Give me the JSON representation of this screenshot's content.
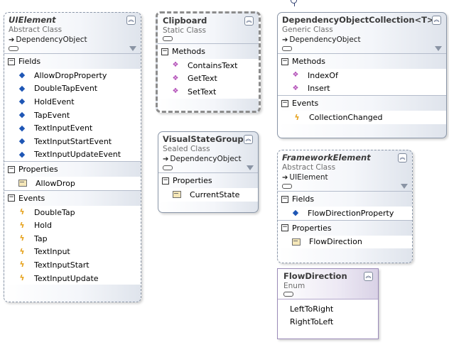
{
  "shapes": {
    "uielement": {
      "name": "UIElement",
      "kind": "Abstract Class",
      "base": "DependencyObject",
      "fields_title": "Fields",
      "fields": [
        "AllowDropProperty",
        "DoubleTapEvent",
        "HoldEvent",
        "TapEvent",
        "TextInputEvent",
        "TextInputStartEvent",
        "TextInputUpdateEvent"
      ],
      "properties_title": "Properties",
      "properties": [
        "AllowDrop"
      ],
      "events_title": "Events",
      "events": [
        "DoubleTap",
        "Hold",
        "Tap",
        "TextInput",
        "TextInputStart",
        "TextInputUpdate"
      ]
    },
    "clipboard": {
      "name": "Clipboard",
      "kind": "Static Class",
      "methods_title": "Methods",
      "methods": [
        "ContainsText",
        "GetText",
        "SetText"
      ]
    },
    "visualstategroup": {
      "name": "VisualStateGroup",
      "kind": "Sealed Class",
      "base": "DependencyObject",
      "properties_title": "Properties",
      "properties": [
        "CurrentState"
      ]
    },
    "dependencyobjectcollection": {
      "name": "DependencyObjectCollection<T>",
      "kind": "Generic Class",
      "base": "DependencyObject",
      "methods_title": "Methods",
      "methods": [
        "IndexOf",
        "Insert"
      ],
      "events_title": "Events",
      "events": [
        "CollectionChanged"
      ]
    },
    "frameworkelement": {
      "name": "FrameworkElement",
      "kind": "Abstract Class",
      "base": "UIElement",
      "fields_title": "Fields",
      "fields": [
        "FlowDirectionProperty"
      ],
      "properties_title": "Properties",
      "properties": [
        "FlowDirection"
      ]
    },
    "flowdirection": {
      "name": "FlowDirection",
      "kind": "Enum",
      "values": [
        "LeftToRight",
        "RightToLeft"
      ]
    }
  },
  "icons": {
    "collapse": "double-chevron-up-icon",
    "inherit": "inheritance-arrow-icon",
    "filter": "filter-funnel-icon",
    "field": "field-diamond-icon",
    "method": "method-cube-icon",
    "event": "event-lightning-icon",
    "property": "property-hand-icon"
  },
  "colors": {
    "border": "#8a96a8",
    "header_gradient_end": "#dfe4ec",
    "field_icon": "#1e56b5",
    "method_icon": "#b14ab6",
    "event_icon": "#e6a21c",
    "enum_border": "#9a8ab8"
  }
}
